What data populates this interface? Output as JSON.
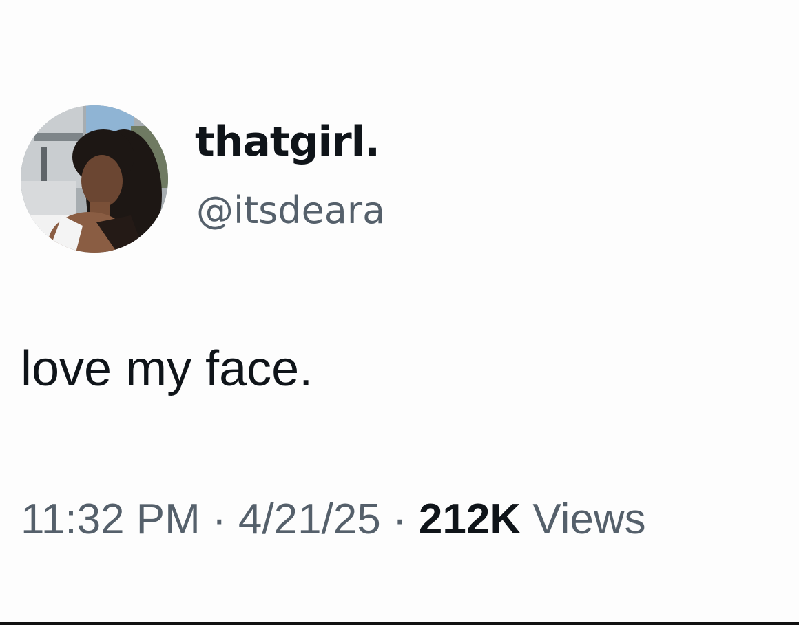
{
  "author": {
    "display_name": "thatgirl.",
    "handle": "@itsdeara",
    "avatar_icon": "profile-photo"
  },
  "tweet": {
    "text": "love my face."
  },
  "meta": {
    "time": "11:32 PM",
    "separator": "·",
    "date": "4/21/25",
    "views_count": "212K",
    "views_label": "Views"
  },
  "colors": {
    "primary_text": "#0f1419",
    "secondary_text": "#55606b",
    "background": "#fdfdfd"
  }
}
